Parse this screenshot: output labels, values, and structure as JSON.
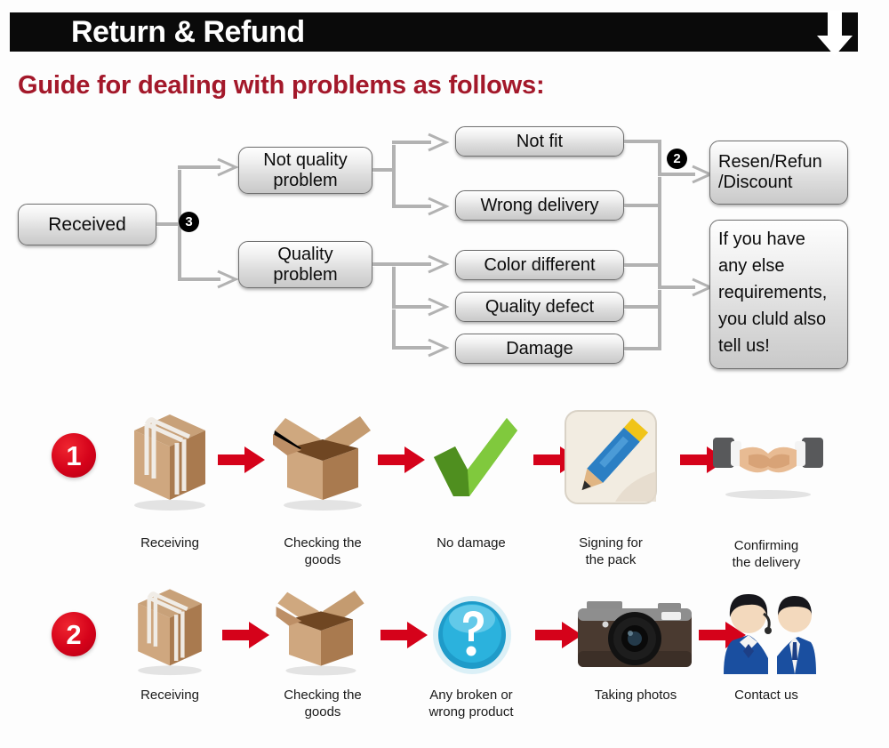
{
  "header": {
    "title": "Return & Refund",
    "arrow_icon": "down-arrow-icon",
    "bar_color": "#0a0a0a",
    "text_color": "#ffffff"
  },
  "guide_heading": {
    "text": "Guide for dealing with problems as follows:",
    "color": "#a3182a"
  },
  "flowchart": {
    "start": {
      "label": "Received"
    },
    "branch_badge_start": "3",
    "branch_badge_merge": "2",
    "categories": [
      {
        "label": "Not quality\nproblem",
        "line1": "Not quality",
        "line2": "problem"
      },
      {
        "label": "Quality\nproblem",
        "line1": "Quality",
        "line2": "problem"
      }
    ],
    "issues": [
      {
        "label": "Not fit",
        "parent": "Not quality problem"
      },
      {
        "label": "Wrong delivery",
        "parent": "Not quality problem"
      },
      {
        "label": "Color different",
        "parent": "Quality problem"
      },
      {
        "label": "Quality defect",
        "parent": "Quality problem"
      },
      {
        "label": "Damage",
        "parent": "Quality problem"
      }
    ],
    "outcomes": [
      {
        "line1": "Resen/Refun",
        "line2": "/Discount"
      },
      {
        "lines": [
          "If you have",
          "any else",
          "requirements,",
          "you cluld also",
          "tell us!"
        ]
      }
    ]
  },
  "process_rows": [
    {
      "number": "1",
      "steps": [
        {
          "icon": "closed-box-icon",
          "caption_line1": "Receiving",
          "caption_line2": ""
        },
        {
          "icon": "open-box-icon",
          "caption_line1": "Checking the",
          "caption_line2": "goods"
        },
        {
          "icon": "green-check-icon",
          "caption_line1": "No damage",
          "caption_line2": ""
        },
        {
          "icon": "pencil-signing-icon",
          "caption_line1": "Signing for",
          "caption_line2": "the pack"
        },
        {
          "icon": "handshake-icon",
          "caption_line1": "Confirming",
          "caption_line2": "the delivery"
        }
      ]
    },
    {
      "number": "2",
      "steps": [
        {
          "icon": "closed-box-icon",
          "caption_line1": "Receiving",
          "caption_line2": ""
        },
        {
          "icon": "open-box-icon",
          "caption_line1": "Checking the",
          "caption_line2": "goods"
        },
        {
          "icon": "question-mark-icon",
          "caption_line1": "Any broken or",
          "caption_line2": "wrong product"
        },
        {
          "icon": "camera-icon",
          "caption_line1": "Taking photos",
          "caption_line2": ""
        },
        {
          "icon": "support-staff-icon",
          "caption_line1": "Contact us",
          "caption_line2": ""
        }
      ]
    }
  ],
  "colors": {
    "background": "#fdfdfd",
    "accent_red": "#d5021a",
    "heading_red": "#a3182a",
    "connector_gray": "#b2b2b2"
  }
}
